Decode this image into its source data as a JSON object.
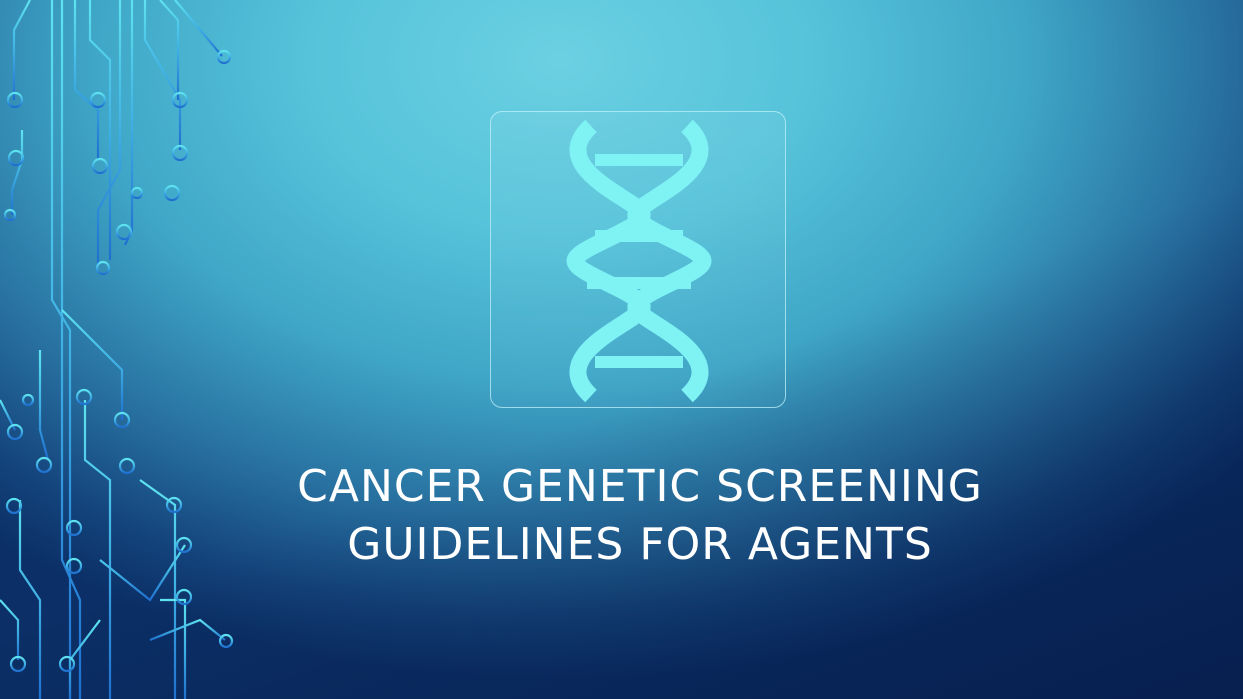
{
  "slide": {
    "title_line1": "CANCER GENETIC SCREENING",
    "title_line2": "GUIDELINES FOR AGENTS",
    "graphic": "dna-icon",
    "decoration": "circuit-lines"
  },
  "colors": {
    "background_light": "#6bd0e2",
    "background_dark": "#0b2f66",
    "dna_fill": "#7ff2f4",
    "circuit_light": "#5fe3f0",
    "circuit_dark": "#1f6fcf",
    "title_text": "#ffffff"
  }
}
